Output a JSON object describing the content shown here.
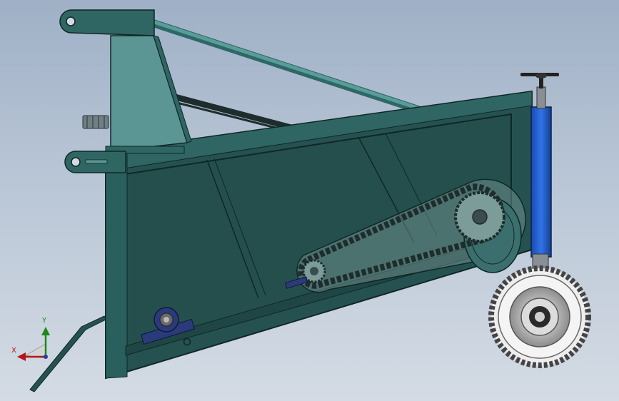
{
  "viewport": {
    "background_top": "#9fb0c6",
    "background_bottom": "#d4dbe4"
  },
  "model": {
    "frame_color": "#255250",
    "frame_edge_color": "#0f2726",
    "frame_light_color": "#4f8c8b",
    "link_color": "#5a9c98",
    "chain_color": "#1e2d2c",
    "guard_color": "#7f9e9c",
    "bearing_color": "#2a3a7a",
    "strut_color": "#1f5fd0",
    "tire_color": "#f0f0f0",
    "tire_tread_color": "#555555"
  },
  "triad": {
    "y_label": "Y",
    "x_label": "X",
    "y_color": "#1a8a1a",
    "x_color": "#b01818"
  }
}
